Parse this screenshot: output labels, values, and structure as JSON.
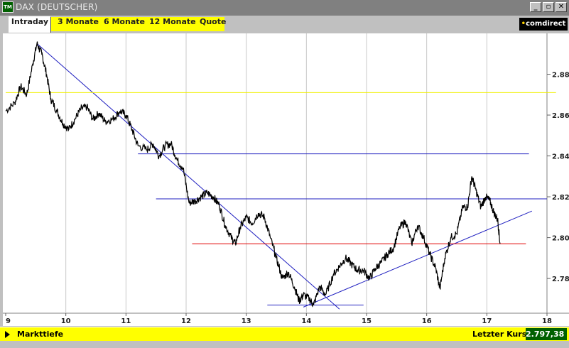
{
  "window": {
    "title": "DAX (DEUTSCHER)",
    "icon_label": "TM",
    "buttons": [
      "_",
      "▫",
      "✕"
    ]
  },
  "tabs": [
    {
      "label": "Intraday",
      "active": true
    },
    {
      "label": "3 Monate",
      "active": false
    },
    {
      "label": "6 Monate",
      "active": false
    },
    {
      "label": "12 Monate",
      "active": false
    },
    {
      "label": "Quote",
      "active": false
    }
  ],
  "logo": {
    "prefix": "•",
    "text": "comdirect"
  },
  "status": {
    "left_label": "Markttiefe",
    "last_label": "Letzter Kurs",
    "last_value": "2.797,38"
  },
  "colors": {
    "accent_yellow": "#ffff00",
    "price_line": "#000000",
    "trend_blue": "#2020c0",
    "support_red": "#e00000",
    "reference_yellow": "#f0f000",
    "value_box": "#006000"
  },
  "chart_data": {
    "type": "line",
    "title": "",
    "xlabel": "",
    "ylabel": "",
    "xlim": [
      9,
      18
    ],
    "ylim": [
      2763,
      2900
    ],
    "x_ticks": [
      9,
      10,
      11,
      12,
      13,
      14,
      15,
      16,
      17,
      18
    ],
    "x_tick_labels": [
      "9",
      "10",
      "11",
      "12",
      "13",
      "14",
      "15",
      "16",
      "17",
      "18"
    ],
    "y_ticks": [
      2780,
      2800,
      2820,
      2840,
      2860,
      2880
    ],
    "y_tick_labels": [
      "2.780",
      "2.800",
      "2.820",
      "2.840",
      "2.860",
      "2.880"
    ],
    "grid": "vertical",
    "series": [
      {
        "values": [
          [
            9.0,
            2862
          ],
          [
            9.15,
            2866
          ],
          [
            9.25,
            2874
          ],
          [
            9.35,
            2870
          ],
          [
            9.45,
            2885
          ],
          [
            9.52,
            2895
          ],
          [
            9.6,
            2890
          ],
          [
            9.68,
            2880
          ],
          [
            9.75,
            2868
          ],
          [
            9.85,
            2862
          ],
          [
            9.95,
            2856
          ],
          [
            10.05,
            2853
          ],
          [
            10.15,
            2858
          ],
          [
            10.25,
            2863
          ],
          [
            10.35,
            2864
          ],
          [
            10.45,
            2858
          ],
          [
            10.55,
            2861
          ],
          [
            10.65,
            2857
          ],
          [
            10.78,
            2858
          ],
          [
            10.9,
            2862
          ],
          [
            11.0,
            2860
          ],
          [
            11.1,
            2853
          ],
          [
            11.2,
            2845
          ],
          [
            11.35,
            2843
          ],
          [
            11.45,
            2846
          ],
          [
            11.55,
            2840
          ],
          [
            11.65,
            2845
          ],
          [
            11.75,
            2846
          ],
          [
            11.85,
            2838
          ],
          [
            11.95,
            2834
          ],
          [
            12.05,
            2817
          ],
          [
            12.15,
            2818
          ],
          [
            12.25,
            2820
          ],
          [
            12.35,
            2822
          ],
          [
            12.45,
            2820
          ],
          [
            12.55,
            2816
          ],
          [
            12.65,
            2806
          ],
          [
            12.75,
            2800
          ],
          [
            12.82,
            2797
          ],
          [
            12.9,
            2805
          ],
          [
            13.0,
            2810
          ],
          [
            13.1,
            2807
          ],
          [
            13.2,
            2812
          ],
          [
            13.3,
            2810
          ],
          [
            13.4,
            2800
          ],
          [
            13.5,
            2790
          ],
          [
            13.6,
            2780
          ],
          [
            13.7,
            2783
          ],
          [
            13.8,
            2776
          ],
          [
            13.88,
            2769
          ],
          [
            13.95,
            2772
          ],
          [
            14.05,
            2770
          ],
          [
            14.12,
            2767
          ],
          [
            14.22,
            2776
          ],
          [
            14.32,
            2772
          ],
          [
            14.45,
            2782
          ],
          [
            14.55,
            2786
          ],
          [
            14.65,
            2790
          ],
          [
            14.75,
            2787
          ],
          [
            14.85,
            2784
          ],
          [
            14.95,
            2784
          ],
          [
            15.05,
            2780
          ],
          [
            15.15,
            2785
          ],
          [
            15.25,
            2788
          ],
          [
            15.35,
            2792
          ],
          [
            15.45,
            2795
          ],
          [
            15.55,
            2805
          ],
          [
            15.65,
            2808
          ],
          [
            15.75,
            2797
          ],
          [
            15.85,
            2806
          ],
          [
            15.95,
            2800
          ],
          [
            16.05,
            2792
          ],
          [
            16.15,
            2785
          ],
          [
            16.22,
            2775
          ],
          [
            16.3,
            2790
          ],
          [
            16.4,
            2800
          ],
          [
            16.5,
            2802
          ],
          [
            16.6,
            2815
          ],
          [
            16.68,
            2815
          ],
          [
            16.75,
            2830
          ],
          [
            16.82,
            2823
          ],
          [
            16.9,
            2815
          ],
          [
            16.98,
            2820
          ],
          [
            17.05,
            2818
          ],
          [
            17.12,
            2812
          ],
          [
            17.18,
            2809
          ],
          [
            17.22,
            2797
          ]
        ]
      }
    ],
    "annotations": [
      {
        "kind": "trendline",
        "color": "blue",
        "points": [
          [
            9.52,
            2895
          ],
          [
            14.55,
            2765
          ]
        ]
      },
      {
        "kind": "trendline",
        "color": "blue",
        "points": [
          [
            13.95,
            2766
          ],
          [
            17.75,
            2813
          ]
        ]
      },
      {
        "kind": "hline",
        "color": "blue",
        "y": 2841,
        "x": [
          11.2,
          17.7
        ]
      },
      {
        "kind": "hline",
        "color": "blue",
        "y": 2819,
        "x": [
          11.5,
          18.0
        ]
      },
      {
        "kind": "hline",
        "color": "red",
        "y": 2797,
        "x": [
          12.1,
          17.65
        ]
      },
      {
        "kind": "hline",
        "color": "blue",
        "y": 2767,
        "x": [
          13.35,
          14.95
        ]
      },
      {
        "kind": "hline",
        "color": "yellow",
        "y": 2871,
        "x": [
          9.0,
          18.15
        ]
      }
    ]
  }
}
